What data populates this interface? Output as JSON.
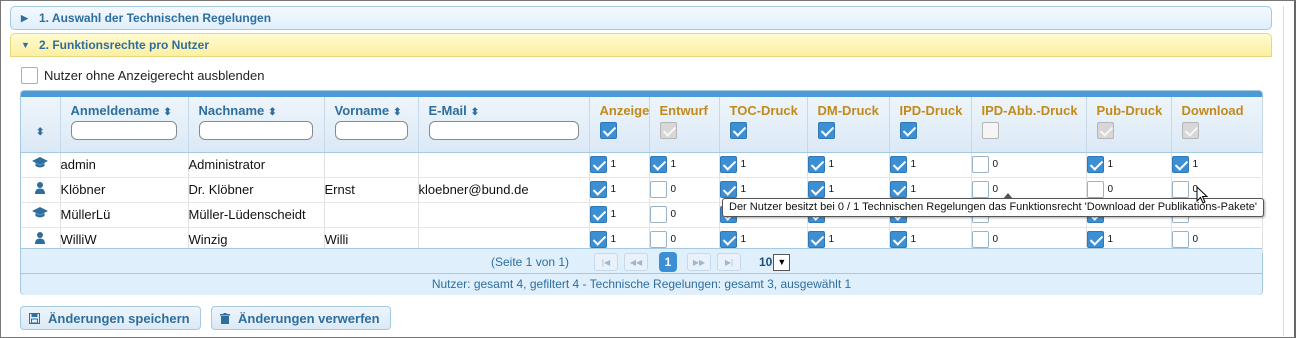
{
  "accordion": {
    "section1": "1. Auswahl der Technischen Regelungen",
    "section2": "2. Funktionsrechte pro Nutzer"
  },
  "toggle": {
    "label": "Nutzer ohne Anzeigerecht ausblenden",
    "checked": false
  },
  "columns": {
    "login": "Anmeldename",
    "lastname": "Nachname",
    "firstname": "Vorname",
    "email": "E-Mail",
    "rights": [
      "Anzeige",
      "Entwurf",
      "TOC-Druck",
      "DM-Druck",
      "IPD-Druck",
      "IPD-Abb.-Druck",
      "Pub-Druck",
      "Download"
    ]
  },
  "header_checks": [
    "on",
    "dis",
    "on",
    "on",
    "on",
    "empty",
    "dis",
    "dis"
  ],
  "rows": [
    {
      "icon": "admin-cap-icon",
      "login": "admin",
      "lastname": "Administrator",
      "firstname": "",
      "email": "",
      "rights": [
        [
          "on",
          "1"
        ],
        [
          "on",
          "1"
        ],
        [
          "on",
          "1"
        ],
        [
          "on",
          "1"
        ],
        [
          "on",
          "1"
        ],
        [
          "off",
          "0"
        ],
        [
          "on",
          "1"
        ],
        [
          "on",
          "1"
        ]
      ]
    },
    {
      "icon": "user-icon",
      "login": "Klöbner",
      "lastname": "Dr. Klöbner",
      "firstname": "Ernst",
      "email": "kloebner@bund.de",
      "rights": [
        [
          "on",
          "1"
        ],
        [
          "off",
          "0"
        ],
        [
          "on",
          "1"
        ],
        [
          "on",
          "1"
        ],
        [
          "on",
          "1"
        ],
        [
          "off",
          "0"
        ],
        [
          "off",
          "0"
        ],
        [
          "off",
          "0"
        ]
      ]
    },
    {
      "icon": "admin-cap-icon",
      "login": "MüllerLü",
      "lastname": "Müller-Lüdenscheidt",
      "firstname": "",
      "email": "",
      "rights": [
        [
          "on",
          "1"
        ],
        [
          "off",
          "0"
        ],
        [
          "on",
          "1"
        ],
        [
          "on",
          "1"
        ],
        [
          "on",
          "1"
        ],
        [
          "off",
          "0"
        ],
        [
          "on",
          "1"
        ],
        [
          "off",
          "0"
        ]
      ]
    },
    {
      "icon": "user-icon",
      "login": "WilliW",
      "lastname": "Winzig",
      "firstname": "Willi",
      "email": "",
      "rights": [
        [
          "on",
          "1"
        ],
        [
          "off",
          "0"
        ],
        [
          "on",
          "1"
        ],
        [
          "on",
          "1"
        ],
        [
          "on",
          "1"
        ],
        [
          "off",
          "0"
        ],
        [
          "on",
          "1"
        ],
        [
          "off",
          "0"
        ]
      ]
    }
  ],
  "pager": {
    "page_text": "(Seite 1 von 1)",
    "current_page": "1",
    "page_size": "10"
  },
  "status": "Nutzer: gesamt 4, gefiltert 4 - Technische Regelungen: gesamt 3, ausgewählt 1",
  "tooltip": "Der Nutzer besitzt bei 0 / 1 Technischen Regelungen das Funktionsrecht 'Download der Publikations-Pakete'",
  "buttons": {
    "save": "Änderungen speichern",
    "discard": "Änderungen verwerfen"
  },
  "colors": {
    "accent": "#2e6e9e",
    "header_gold": "#c28a1a",
    "active_bg": "#fcefa1",
    "check_blue": "#3d8fd4"
  }
}
